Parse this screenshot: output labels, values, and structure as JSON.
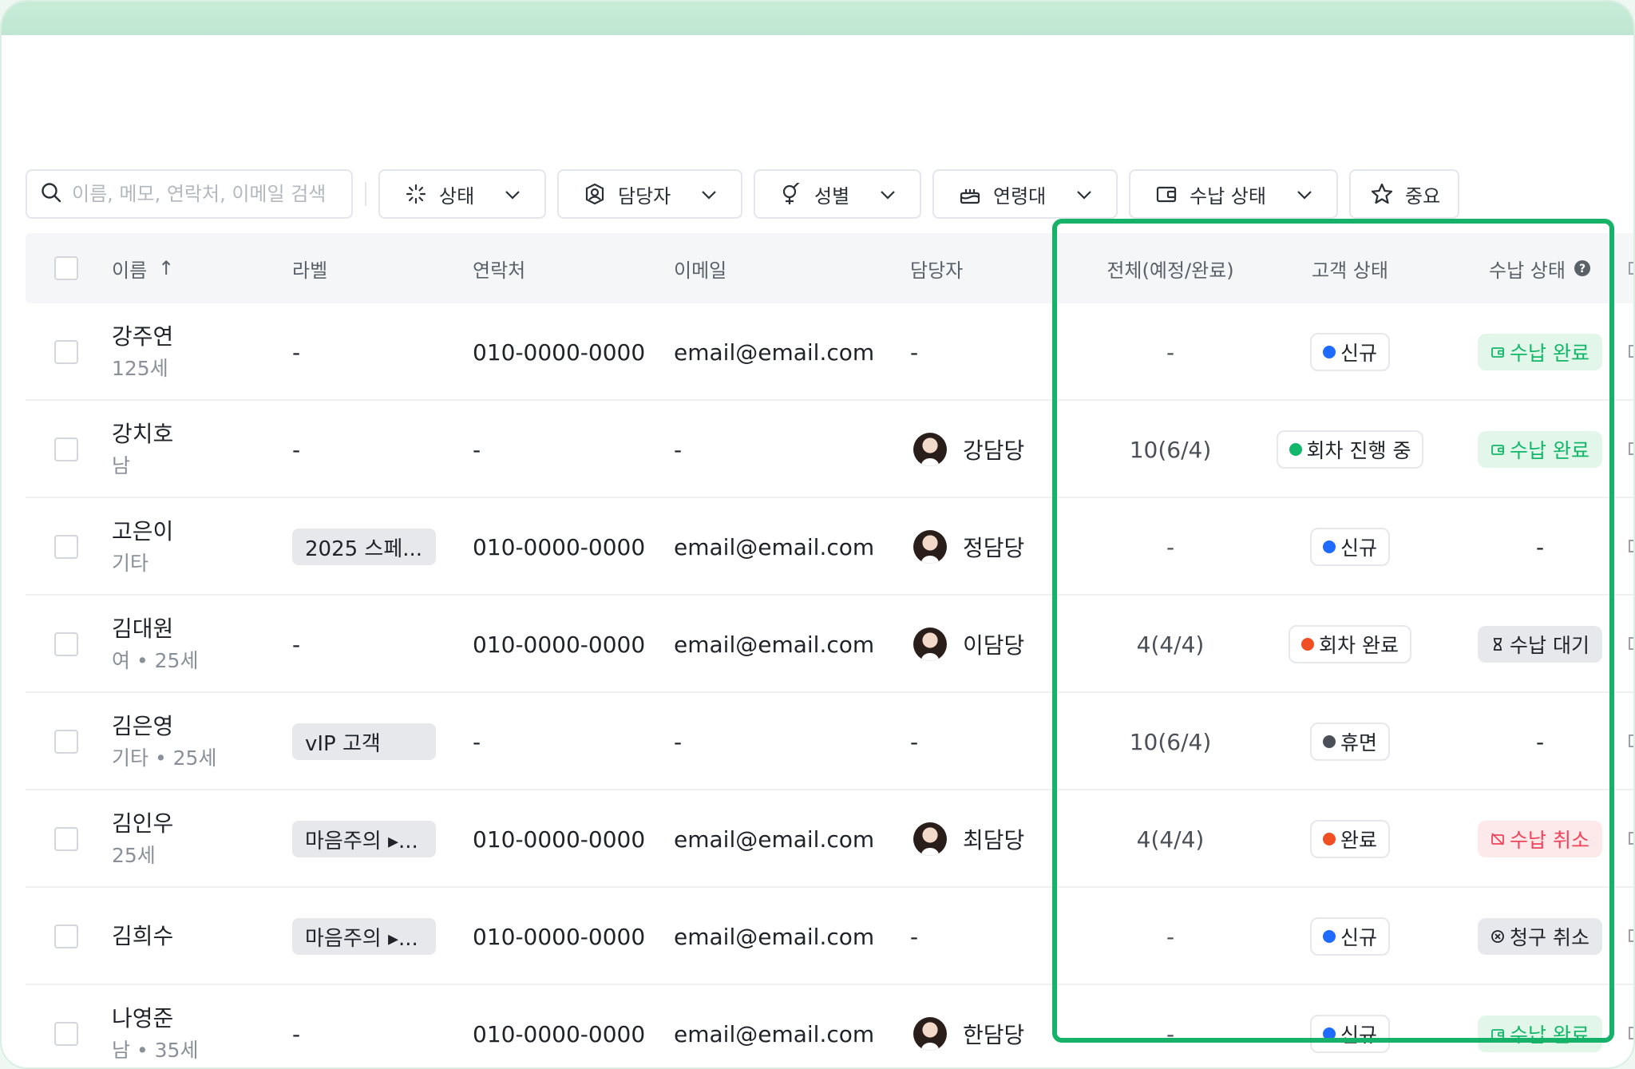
{
  "search": {
    "placeholder": "이름, 메모, 연락처, 이메일 검색"
  },
  "filters": {
    "status": "상태",
    "manager": "담당자",
    "gender": "성별",
    "age": "연령대",
    "payment": "수납 상태",
    "important": "중요"
  },
  "columns": {
    "name": "이름",
    "sort_arrow": "↑",
    "label": "라벨",
    "contact": "연락처",
    "email": "이메일",
    "manager": "담당자",
    "total": "전체(예정/완료)",
    "customer_status": "고객 상태",
    "payment_status": "수납 상태"
  },
  "colors": {
    "accent_green": "#17b26a",
    "dot_blue": "#1f6bff",
    "dot_green": "#12b76a",
    "dot_orange": "#f04e23",
    "dot_gray": "#4b5058"
  },
  "rows": [
    {
      "name": "강주연",
      "sub": "125세",
      "label": "-",
      "label_type": "dash",
      "phone": "010-0000-0000",
      "email": "email@email.com",
      "manager": "-",
      "has_avatar": false,
      "total": "-",
      "status": "신규",
      "status_color": "#1f6bff",
      "payment": "수납 완료",
      "payment_type": "done"
    },
    {
      "name": "강치호",
      "sub": "남",
      "label": "-",
      "label_type": "dash",
      "phone": "-",
      "email": "-",
      "manager": "강담당",
      "has_avatar": true,
      "total": "10(6/4)",
      "status": "회차 진행 중",
      "status_color": "#12b76a",
      "payment": "수납 완료",
      "payment_type": "done"
    },
    {
      "name": "고은이",
      "sub": "기타",
      "label": "2025 스페...",
      "label_type": "pill",
      "phone": "010-0000-0000",
      "email": "email@email.com",
      "manager": "정담당",
      "has_avatar": true,
      "total": "-",
      "status": "신규",
      "status_color": "#1f6bff",
      "payment": "-",
      "payment_type": "dash"
    },
    {
      "name": "김대원",
      "sub": "여 • 25세",
      "label": "-",
      "label_type": "dash",
      "phone": "010-0000-0000",
      "email": "email@email.com",
      "manager": "이담당",
      "has_avatar": true,
      "total": "4(4/4)",
      "status": "회차 완료",
      "status_color": "#f04e23",
      "payment": "수납 대기",
      "payment_type": "wait"
    },
    {
      "name": "김은영",
      "sub": "기타 • 25세",
      "label": "vIP 고객",
      "label_type": "pill",
      "phone": "-",
      "email": "-",
      "manager": "-",
      "has_avatar": false,
      "total": "10(6/4)",
      "status": "휴면",
      "status_color": "#4b5058",
      "payment": "-",
      "payment_type": "dash"
    },
    {
      "name": "김인우",
      "sub": "25세",
      "label": "마음주의 ▸...",
      "label_type": "pill",
      "phone": "010-0000-0000",
      "email": "email@email.com",
      "manager": "최담당",
      "has_avatar": true,
      "total": "4(4/4)",
      "status": "완료",
      "status_color": "#f04e23",
      "payment": "수납 취소",
      "payment_type": "cancel"
    },
    {
      "name": "김희수",
      "sub": "",
      "label": "마음주의 ▸...",
      "label_type": "pill",
      "phone": "010-0000-0000",
      "email": "email@email.com",
      "manager": "-",
      "has_avatar": false,
      "total": "-",
      "status": "신규",
      "status_color": "#1f6bff",
      "payment": "청구 취소",
      "payment_type": "billcancel"
    },
    {
      "name": "나영준",
      "sub": "남 • 35세",
      "label": "-",
      "label_type": "dash",
      "phone": "010-0000-0000",
      "email": "email@email.com",
      "manager": "한담당",
      "has_avatar": true,
      "total": "-",
      "status": "신규",
      "status_color": "#1f6bff",
      "payment": "수납 완료",
      "payment_type": "done"
    }
  ]
}
